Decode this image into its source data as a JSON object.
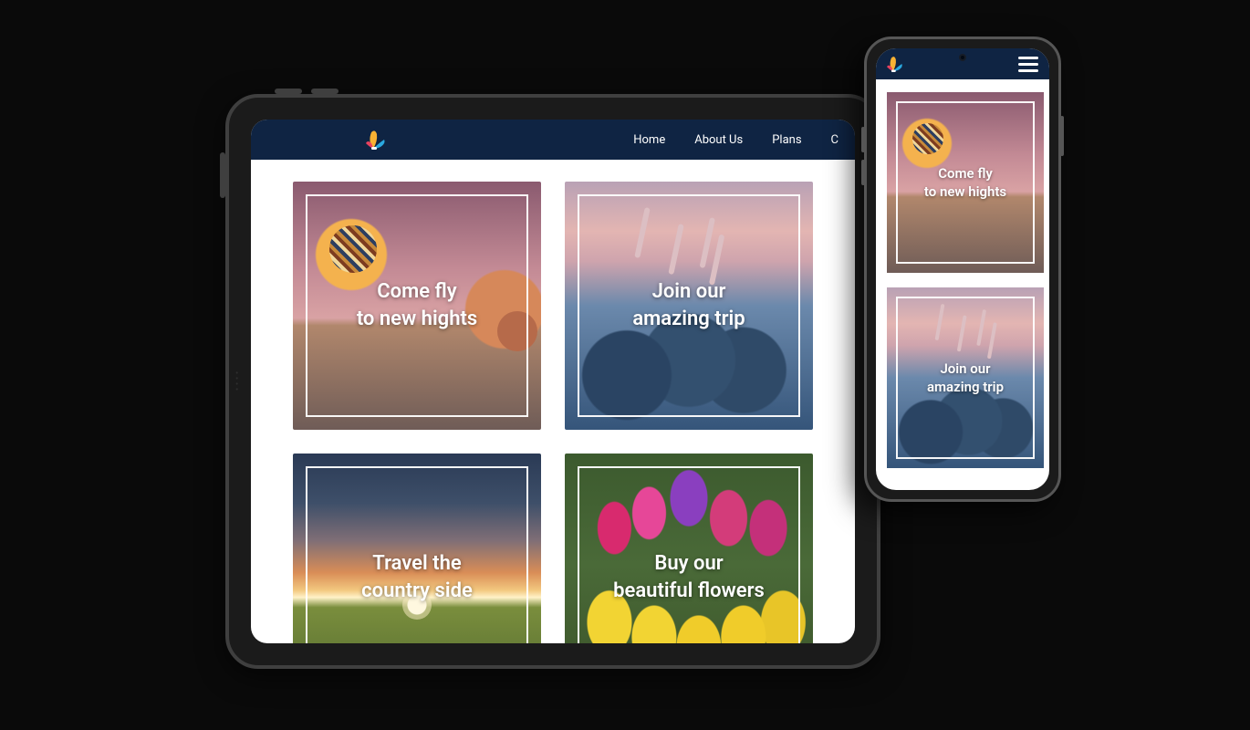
{
  "nav": {
    "items": [
      "Home",
      "About Us",
      "Plans",
      "C"
    ]
  },
  "cards": {
    "balloon": "Come fly\nto new hights",
    "trip": "Join our\namazing trip",
    "country": "Travel the\ncountry side",
    "flowers": "Buy our\nbeautiful flowers"
  },
  "phone_cards": {
    "balloon": "Come fly\nto new hights",
    "trip": "Join our\namazing trip"
  }
}
